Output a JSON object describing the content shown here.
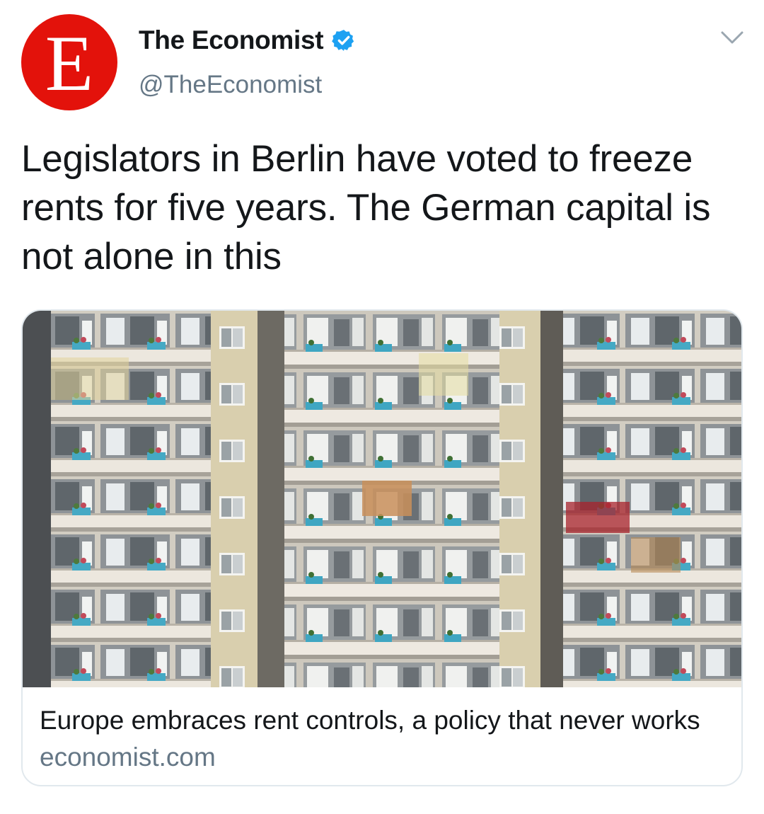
{
  "account": {
    "logo_letter": "E",
    "display_name": "The Economist",
    "handle": "@TheEconomist",
    "verified": true
  },
  "tweet": {
    "text": "Legislators in Berlin have voted to freeze rents for five years. The German capital is not alone in this"
  },
  "link_card": {
    "image_icon": "apartment-building-photo",
    "title": "Europe embraces rent controls, a policy that never works",
    "domain": "economist.com"
  },
  "colors": {
    "brand_red": "#e3120b",
    "verified_blue": "#1da1f2",
    "secondary_text": "#657786",
    "card_border": "#e1e8ed"
  }
}
